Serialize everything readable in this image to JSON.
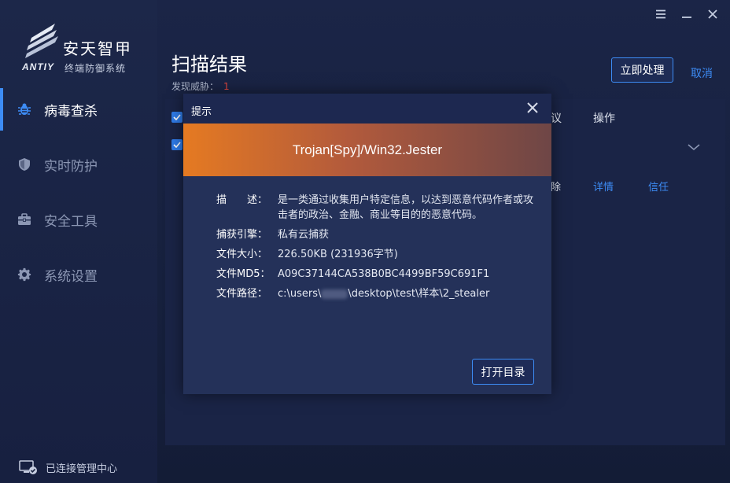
{
  "window_controls": {
    "menu_icon": "menu-icon",
    "minimize_icon": "minimize-icon",
    "close_icon": "close-icon"
  },
  "brand": {
    "name": "安天智甲",
    "subtitle": "终端防御系统",
    "logo_text": "ANTIY"
  },
  "sidebar": {
    "items": [
      {
        "label": "病毒查杀",
        "icon": "bug-icon",
        "active": true
      },
      {
        "label": "实时防护",
        "icon": "shield-icon",
        "active": false
      },
      {
        "label": "安全工具",
        "icon": "toolbox-icon",
        "active": false
      },
      {
        "label": "系统设置",
        "icon": "gear-icon",
        "active": false
      }
    ],
    "connection_status": "已连接管理中心"
  },
  "main": {
    "title": "扫描结果",
    "threat_label": "发现威胁：",
    "threat_count": "1",
    "handle_button": "立即处理",
    "cancel_link": "取消",
    "table": {
      "suggestion_header_partial": "议",
      "operation_header": "操作",
      "row_action_partial": "除",
      "detail_link": "详情",
      "trust_link": "信任"
    }
  },
  "dialog": {
    "title": "提示",
    "threat_name": "Trojan[Spy]/Win32.Jester",
    "fields": [
      {
        "label": "描　　述：",
        "value": "是一类通过收集用户特定信息，以达到恶意代码作者或攻击者的政治、金融、商业等目的的恶意代码。"
      },
      {
        "label": "捕获引擎：",
        "value": "私有云捕获"
      },
      {
        "label": "文件大小：",
        "value": "226.50KB (231936字节)"
      },
      {
        "label": "文件MD5：",
        "value": "A09C37144CA538B0BC4499BF59C691F1"
      }
    ],
    "path_label": "文件路径：",
    "path_prefix": "c:\\users\\",
    "path_suffix": "\\desktop\\test\\样本\\2_stealer",
    "open_dir_button": "打开目录"
  },
  "colors": {
    "accent": "#3d8cf5",
    "banner_start": "#e57a22",
    "banner_end": "#6e4646",
    "threat": "#e0463e"
  }
}
